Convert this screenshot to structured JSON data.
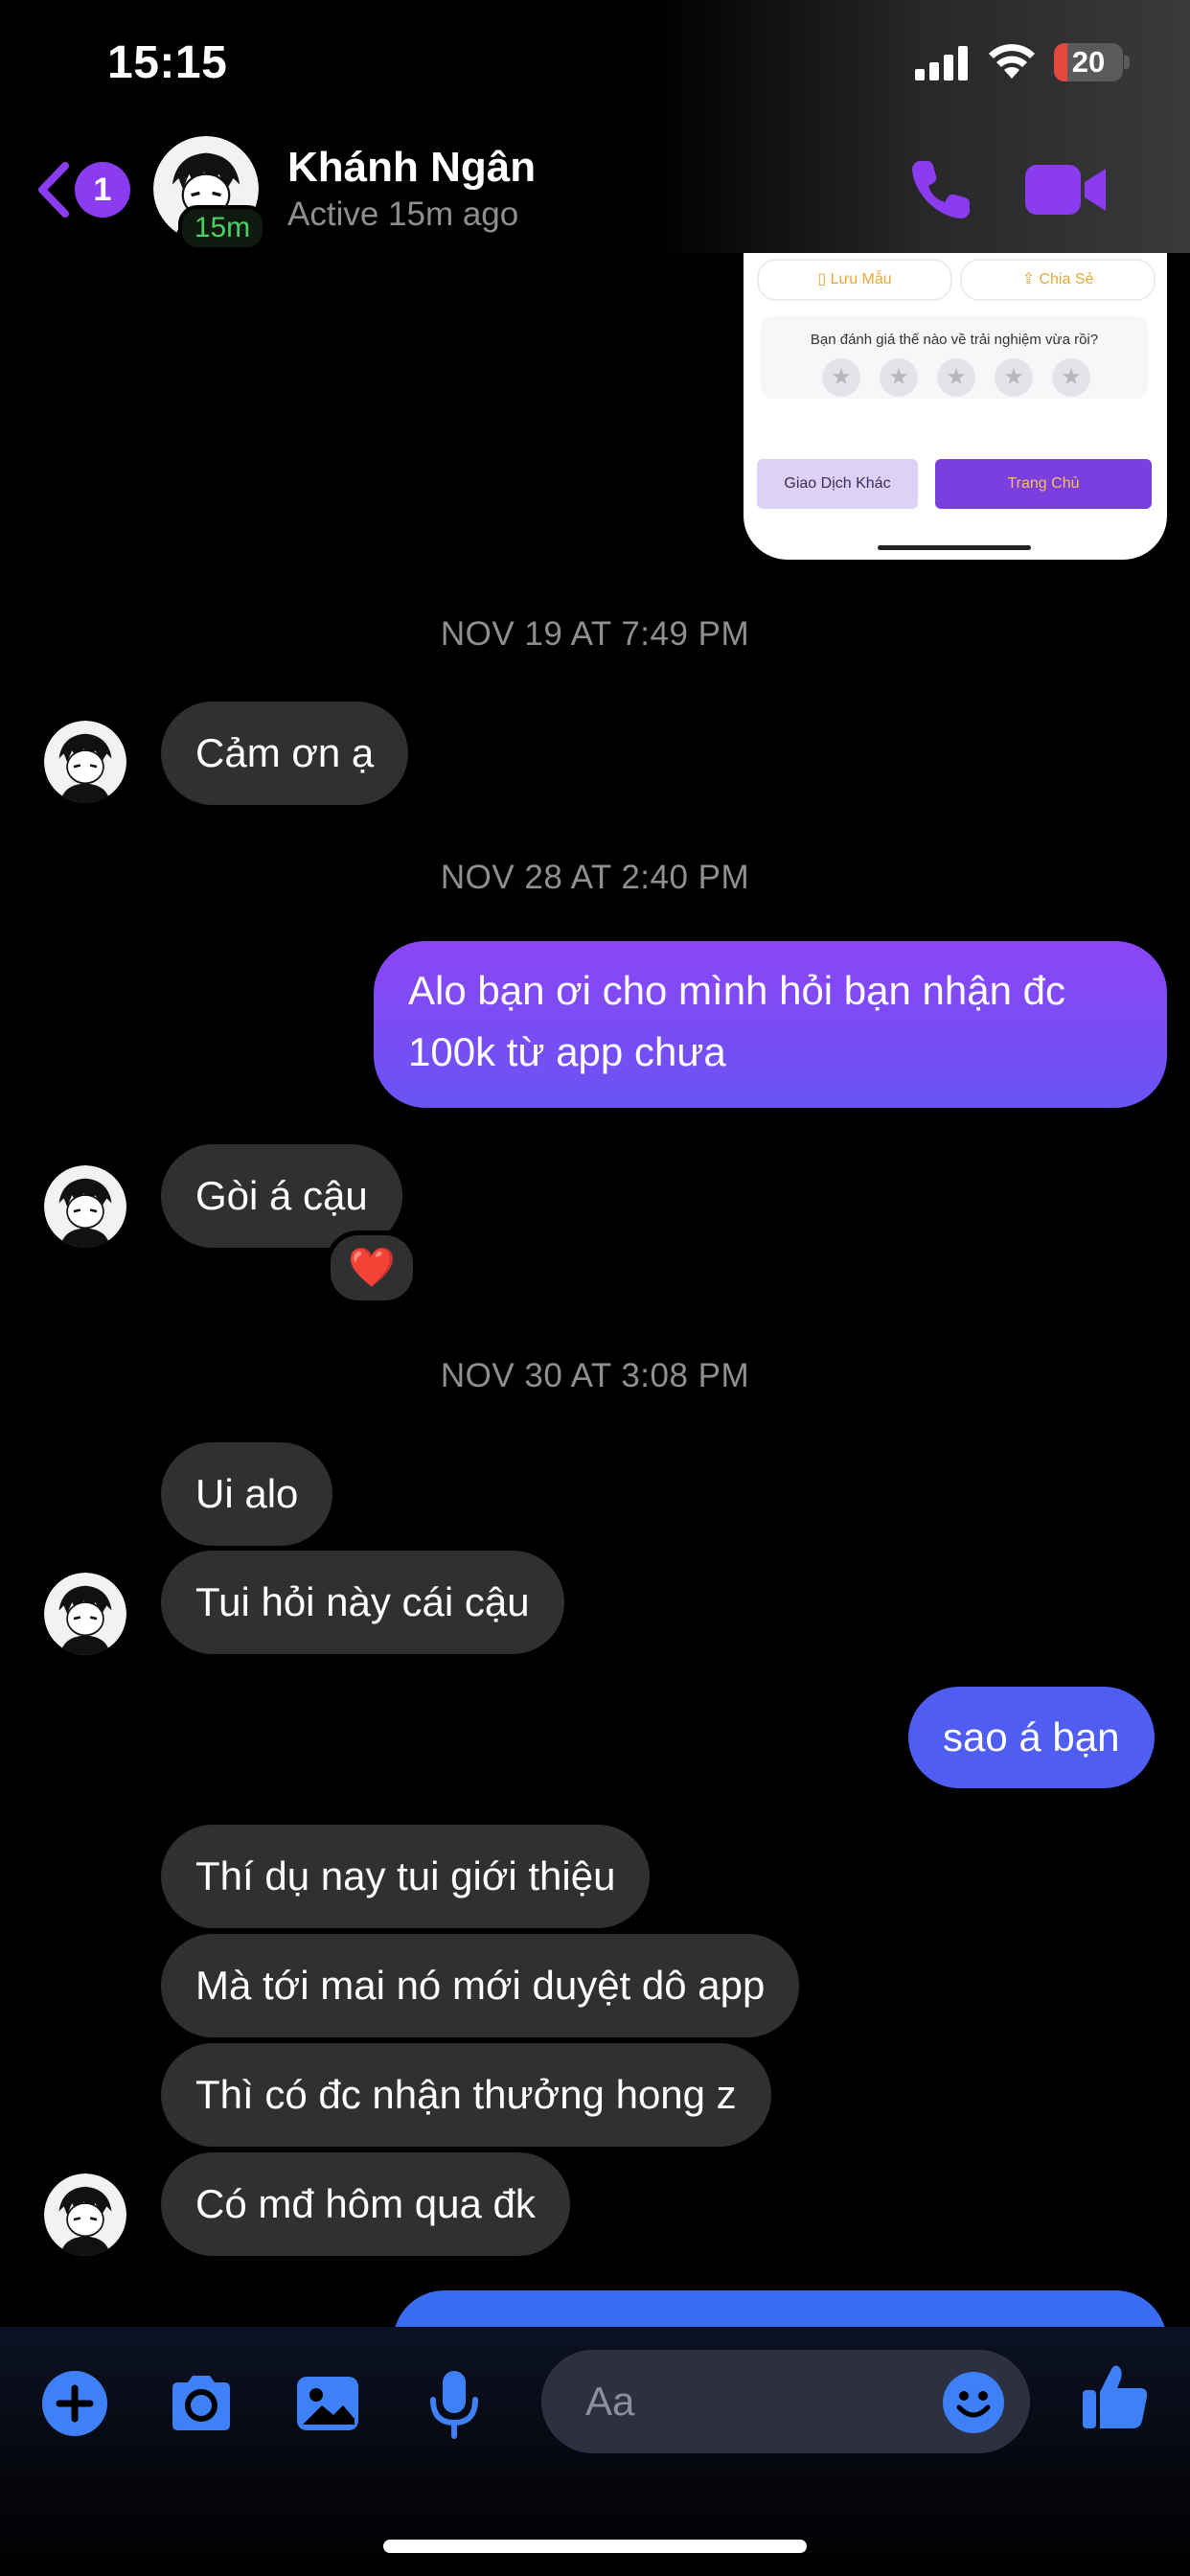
{
  "status_bar": {
    "time": "15:15",
    "battery": "20",
    "battery_level": 0.2
  },
  "header": {
    "unread_count": "1",
    "contact_name": "Khánh Ngân",
    "active_badge": "15m",
    "status": "Active 15m ago",
    "icons": {
      "back": "chevron-left-icon",
      "call": "phone-icon",
      "video": "video-camera-icon"
    },
    "accent_color": "#8b3cf0"
  },
  "shared_image": {
    "save_label": "Lưu Mẫu",
    "share_label": "Chia Sẻ",
    "question": "Bạn đánh giá thế nào về trải nghiệm vừa rồi?",
    "star_count": 5,
    "other_label": "Giao Dịch Khác",
    "home_label": "Trang Chủ"
  },
  "conversation": {
    "timestamps": [
      "NOV 19 AT 7:49 PM",
      "NOV 28 AT 2:40 PM",
      "NOV 30 AT 3:08 PM"
    ],
    "messages": [
      {
        "sender": "contact",
        "text": "Cảm ơn ạ"
      },
      {
        "sender": "me",
        "line1": "Alo bạn ơi cho mình hỏi bạn nhận đc",
        "line2": "100k từ app chưa"
      },
      {
        "sender": "contact",
        "text": "Gòi á cậu",
        "reaction": "❤️"
      },
      {
        "sender": "contact",
        "text": "Ui alo"
      },
      {
        "sender": "contact",
        "text": "Tui hỏi này cái cậu"
      },
      {
        "sender": "me",
        "text": "sao á bạn"
      },
      {
        "sender": "contact",
        "text": "Thí dụ nay tui giới thiệu"
      },
      {
        "sender": "contact",
        "text": "Mà tới mai nó mới duyệt dô app"
      },
      {
        "sender": "contact",
        "text": "Thì có đc nhận thưởng hong z"
      },
      {
        "sender": "contact",
        "text": "Có mđ hôm qua đk"
      }
    ],
    "colors": {
      "incoming": "#303030",
      "outgoing_top": "#8b45f5",
      "outgoing_mid": "#4f5df3",
      "outgoing_bottom": "#3a6cf2"
    }
  },
  "composer": {
    "placeholder": "Aa",
    "icons": [
      "plus-icon",
      "camera-icon",
      "photo-icon",
      "microphone-icon",
      "emoji-icon",
      "thumbs-up-icon"
    ],
    "accent_color": "#3e80f6"
  }
}
